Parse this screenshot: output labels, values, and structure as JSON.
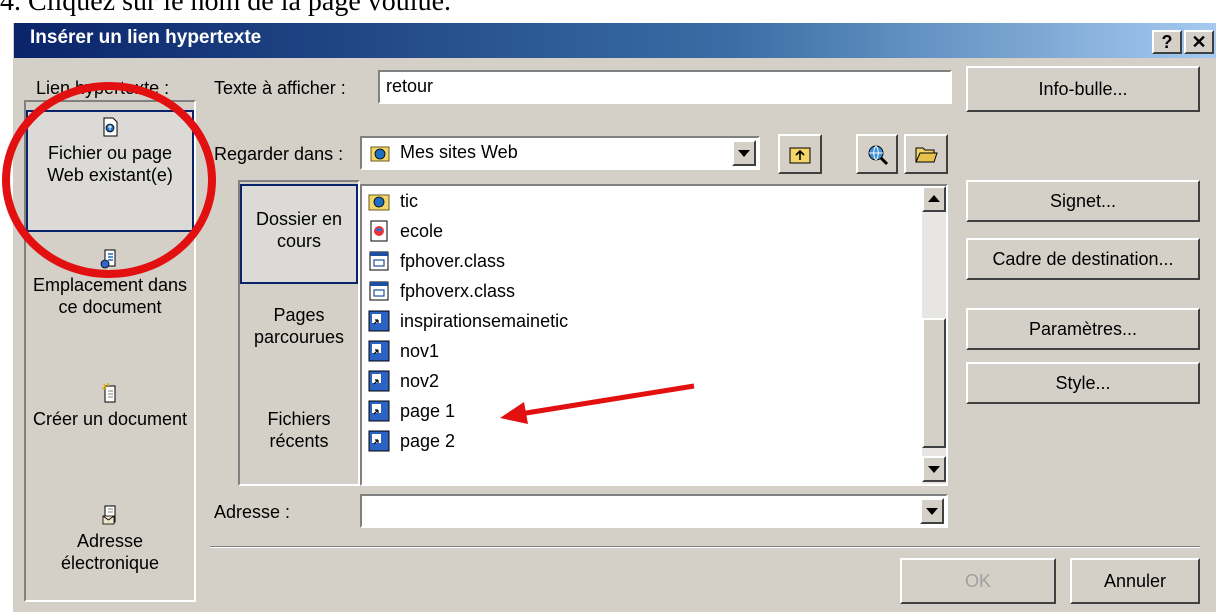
{
  "caption": "4. Cliquez sur le nom de la page voulue.",
  "window": {
    "title": "Insérer un lien hypertexte",
    "help_label": "?",
    "close_label": "✕"
  },
  "sidebar": {
    "heading": "Lien hypertexte :",
    "items": [
      {
        "label": "Fichier ou page Web existant(e)",
        "icon": "existing-file-icon",
        "selected": true
      },
      {
        "label": "Emplacement dans ce document",
        "icon": "place-in-document-icon",
        "selected": false
      },
      {
        "label": "Créer un document",
        "icon": "new-document-icon",
        "selected": false
      },
      {
        "label": "Adresse électronique",
        "icon": "email-address-icon",
        "selected": false
      }
    ]
  },
  "text_to_display": {
    "label": "Texte à afficher :",
    "value": "retour"
  },
  "look_in": {
    "label": "Regarder dans :",
    "value": "Mes sites Web"
  },
  "places": [
    {
      "label": "Dossier en cours",
      "selected": true
    },
    {
      "label": "Pages parcourues",
      "selected": false
    },
    {
      "label": "Fichiers récents",
      "selected": false
    }
  ],
  "files": [
    {
      "name": "tic",
      "icon": "web-folder-icon"
    },
    {
      "name": "ecole",
      "icon": "html-page-icon"
    },
    {
      "name": "fphover.class",
      "icon": "class-file-icon"
    },
    {
      "name": "fphoverx.class",
      "icon": "class-file-icon"
    },
    {
      "name": "inspirationsemainetic",
      "icon": "web-shortcut-icon"
    },
    {
      "name": "nov1",
      "icon": "web-shortcut-icon"
    },
    {
      "name": "nov2",
      "icon": "web-shortcut-icon"
    },
    {
      "name": "page 1",
      "icon": "web-shortcut-icon"
    },
    {
      "name": "page 2",
      "icon": "web-shortcut-icon"
    }
  ],
  "address": {
    "label": "Adresse :",
    "value": ""
  },
  "buttons": {
    "tooltip": "Info-bulle...",
    "bookmark": "Signet...",
    "target_frame": "Cadre de destination...",
    "parameters": "Paramètres...",
    "style": "Style...",
    "ok": "OK",
    "cancel": "Annuler"
  },
  "colors": {
    "title_gradient_start": "#0a246a",
    "title_gradient_end": "#a6caf0",
    "dialog_face": "#d4d0c8",
    "annotation_red": "#e21010"
  }
}
